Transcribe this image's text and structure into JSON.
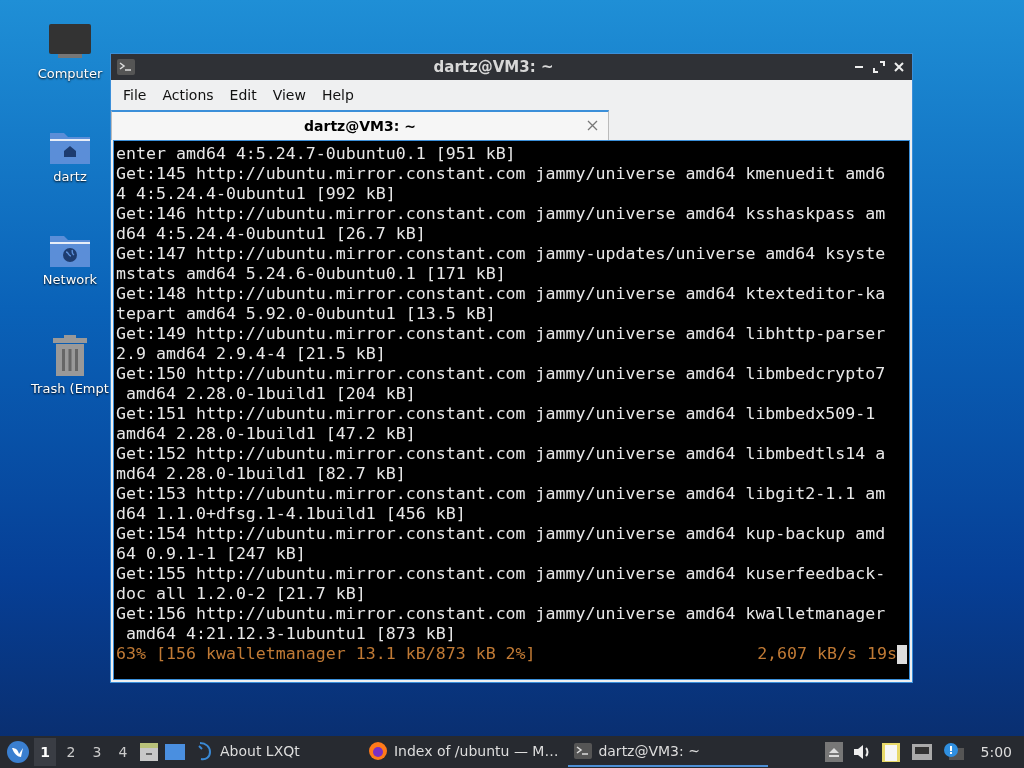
{
  "desktop_icons": [
    {
      "kind": "computer",
      "label": "Computer"
    },
    {
      "kind": "home",
      "label": "dartz"
    },
    {
      "kind": "network",
      "label": "Network"
    },
    {
      "kind": "trash",
      "label": "Trash (Empt"
    }
  ],
  "window": {
    "title": "dartz@VM3: ~",
    "menu": [
      "File",
      "Actions",
      "Edit",
      "View",
      "Help"
    ],
    "tabs": [
      {
        "label": "dartz@VM3: ~",
        "selected": true
      }
    ],
    "lines": [
      "enter amd64 4:5.24.7-0ubuntu0.1 [951 kB]",
      "Get:145 http://ubuntu.mirror.constant.com jammy/universe amd64 kmenuedit amd6",
      "4 4:5.24.4-0ubuntu1 [992 kB]",
      "Get:146 http://ubuntu.mirror.constant.com jammy/universe amd64 ksshaskpass am",
      "d64 4:5.24.4-0ubuntu1 [26.7 kB]",
      "Get:147 http://ubuntu.mirror.constant.com jammy-updates/universe amd64 ksyste",
      "mstats amd64 5.24.6-0ubuntu0.1 [171 kB]",
      "Get:148 http://ubuntu.mirror.constant.com jammy/universe amd64 ktexteditor-ka",
      "tepart amd64 5.92.0-0ubuntu1 [13.5 kB]",
      "Get:149 http://ubuntu.mirror.constant.com jammy/universe amd64 libhttp-parser",
      "2.9 amd64 2.9.4-4 [21.5 kB]",
      "Get:150 http://ubuntu.mirror.constant.com jammy/universe amd64 libmbedcrypto7",
      " amd64 2.28.0-1build1 [204 kB]",
      "Get:151 http://ubuntu.mirror.constant.com jammy/universe amd64 libmbedx509-1",
      "amd64 2.28.0-1build1 [47.2 kB]",
      "Get:152 http://ubuntu.mirror.constant.com jammy/universe amd64 libmbedtls14 a",
      "md64 2.28.0-1build1 [82.7 kB]",
      "Get:153 http://ubuntu.mirror.constant.com jammy/universe amd64 libgit2-1.1 am",
      "d64 1.1.0+dfsg.1-4.1build1 [456 kB]",
      "Get:154 http://ubuntu.mirror.constant.com jammy/universe amd64 kup-backup amd",
      "64 0.9.1-1 [247 kB]",
      "Get:155 http://ubuntu.mirror.constant.com jammy/universe amd64 kuserfeedback-",
      "doc all 1.2.0-2 [21.7 kB]",
      "Get:156 http://ubuntu.mirror.constant.com jammy/universe amd64 kwalletmanager",
      " amd64 4:21.12.3-1ubuntu1 [873 kB]"
    ],
    "progress": {
      "left": "63% [156 kwalletmanager 13.1 kB/873 kB 2%]",
      "right": "2,607 kB/s 19s"
    }
  },
  "taskbar": {
    "workspaces": [
      {
        "label": "1",
        "selected": true
      },
      {
        "label": "2",
        "selected": false
      },
      {
        "label": "3",
        "selected": false
      },
      {
        "label": "4",
        "selected": false
      }
    ],
    "tasks": [
      {
        "kind": "about",
        "label": "About LXQt",
        "selected": false
      },
      {
        "kind": "browser",
        "label": "Index of /ubuntu — M…",
        "selected": false
      },
      {
        "kind": "terminal",
        "label": "dartz@VM3: ~",
        "selected": true
      }
    ],
    "clock": "5:00"
  }
}
